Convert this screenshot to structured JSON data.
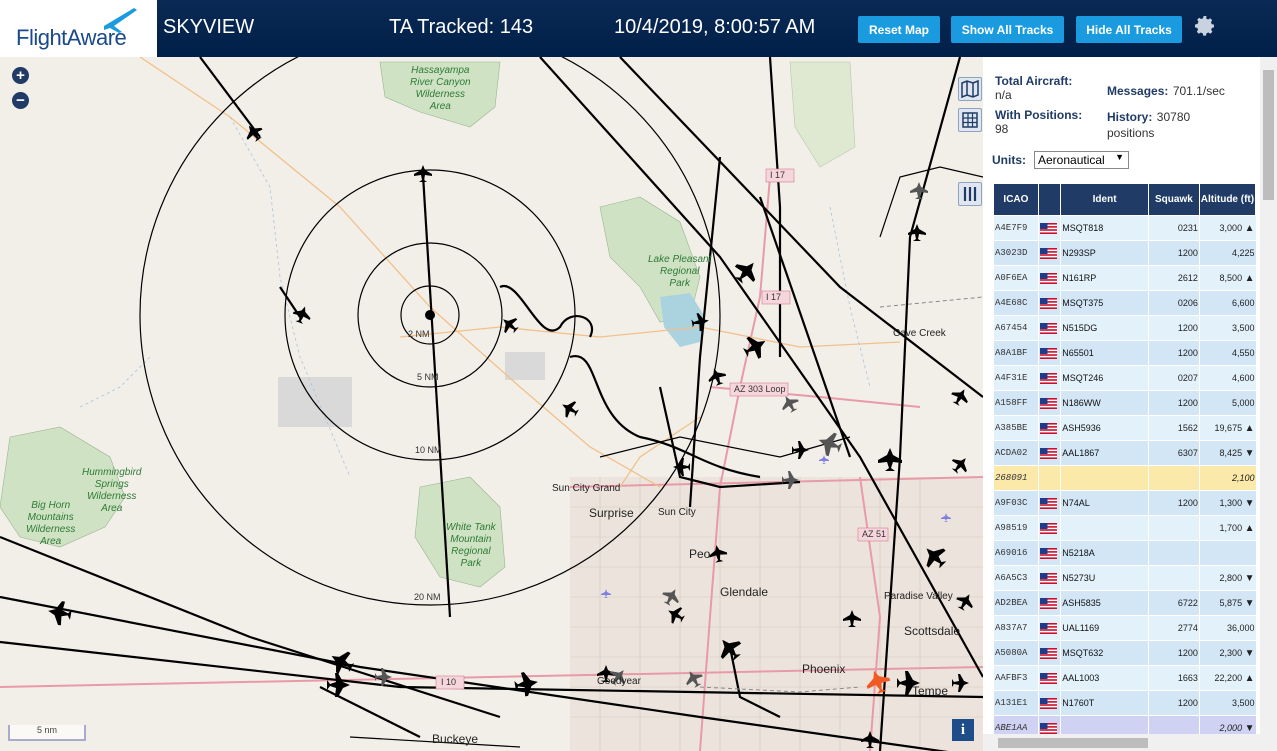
{
  "header": {
    "logo_text": "FlightAware",
    "app_title": "SKYVIEW",
    "tracked": "TA Tracked: 143",
    "datetime": "10/4/2019, 8:00:57 AM",
    "reset_map": "Reset Map",
    "show_all": "Show All Tracks",
    "hide_all": "Hide All Tracks"
  },
  "map": {
    "zoom_in": "+",
    "zoom_out": "−",
    "scale_label": "5 nm",
    "info": "i",
    "range_rings": [
      "2 NM",
      "5 NM",
      "10 NM",
      "20 NM"
    ],
    "places": [
      {
        "name": "Hassayampa River Canyon Wilderness Area",
        "lines": [
          "Hassayampa",
          "River Canyon",
          "Wilderness",
          "Area"
        ]
      },
      {
        "name": "Lake Pleasant Regional Park",
        "lines": [
          "Lake Pleasant",
          "Regional",
          "Park"
        ]
      },
      {
        "name": "Hummingbird Springs Wilderness Area",
        "lines": [
          "Hummingbird",
          "Springs",
          "Wilderness",
          "Area"
        ]
      },
      {
        "name": "Big Horn Mountains Wilderness Area",
        "lines": [
          "Big Horn",
          "Mountains",
          "Wilderness",
          "Area"
        ]
      },
      {
        "name": "White Tank Mountain Regional Park",
        "lines": [
          "White Tank",
          "Mountain",
          "Regional",
          "Park"
        ]
      }
    ],
    "cities": {
      "cave_creek": "Cave Creek",
      "sun_city_grand": "Sun City Grand",
      "surprise": "Surprise",
      "sun_city": "Sun City",
      "peoria": "Peo",
      "glendale": "Glendale",
      "paradise_valley": "Paradise Valley",
      "scottsdale": "Scottsdale",
      "phoenix": "Phoenix",
      "tempe": "Tempe",
      "goodyear": "Goodyear",
      "buckeye": "Buckeye"
    },
    "roads": {
      "i17_a": "I 17",
      "i17_b": "I 17",
      "loop303": "AZ 303 Loop",
      "i10": "I 10",
      "az51": "AZ 51"
    }
  },
  "stats": {
    "total_label": "Total Aircraft:",
    "total_value": "n/a",
    "messages_label": "Messages:",
    "messages_value": "701.1/sec",
    "positions_label": "With Positions:",
    "positions_value": "98",
    "history_label": "History:",
    "history_value": "30780",
    "history_unit": "positions",
    "units_label": "Units:",
    "units_value": "Aeronautical"
  },
  "table": {
    "headers": {
      "icao": "ICAO",
      "ident": "Ident",
      "squawk": "Squawk",
      "altitude": "Altitude (ft)"
    },
    "rows": [
      {
        "icao": "A4E7F9",
        "ident": "MSQT818",
        "squawk": "0231",
        "alt": "3,000",
        "trend": "▲"
      },
      {
        "icao": "A3023D",
        "ident": "N293SP",
        "squawk": "1200",
        "alt": "4,225",
        "trend": ""
      },
      {
        "icao": "A0F6EA",
        "ident": "N161RP",
        "squawk": "2612",
        "alt": "8,500",
        "trend": "▲"
      },
      {
        "icao": "A4E68C",
        "ident": "MSQT375",
        "squawk": "0206",
        "alt": "6,600",
        "trend": ""
      },
      {
        "icao": "A67454",
        "ident": "N515DG",
        "squawk": "1200",
        "alt": "3,500",
        "trend": ""
      },
      {
        "icao": "A8A1BF",
        "ident": "N65501",
        "squawk": "1200",
        "alt": "4,550",
        "trend": ""
      },
      {
        "icao": "A4F31E",
        "ident": "MSQT246",
        "squawk": "0207",
        "alt": "4,600",
        "trend": ""
      },
      {
        "icao": "A158FF",
        "ident": "N186WW",
        "squawk": "1200",
        "alt": "5,000",
        "trend": ""
      },
      {
        "icao": "A385BE",
        "ident": "ASH5936",
        "squawk": "1562",
        "alt": "19,675",
        "trend": "▲"
      },
      {
        "icao": "ACDA02",
        "ident": "AAL1867",
        "squawk": "6307",
        "alt": "8,425",
        "trend": "▼"
      },
      {
        "icao": "268091",
        "ident": "",
        "squawk": "",
        "alt": "2,100",
        "trend": ""
      },
      {
        "icao": "A9F03C",
        "ident": "N74AL",
        "squawk": "1200",
        "alt": "1,300",
        "trend": "▼"
      },
      {
        "icao": "A98519",
        "ident": "",
        "squawk": "",
        "alt": "1,700",
        "trend": "▲"
      },
      {
        "icao": "A69016",
        "ident": "N5218A",
        "squawk": "",
        "alt": "",
        "trend": ""
      },
      {
        "icao": "A6A5C3",
        "ident": "N5273U",
        "squawk": "",
        "alt": "2,800",
        "trend": "▼"
      },
      {
        "icao": "AD2BEA",
        "ident": "ASH5835",
        "squawk": "6722",
        "alt": "5,875",
        "trend": "▼"
      },
      {
        "icao": "A837A7",
        "ident": "UAL1169",
        "squawk": "2774",
        "alt": "36,000",
        "trend": ""
      },
      {
        "icao": "A5080A",
        "ident": "MSQT632",
        "squawk": "1200",
        "alt": "2,300",
        "trend": "▼"
      },
      {
        "icao": "AAFBF3",
        "ident": "AAL1003",
        "squawk": "1663",
        "alt": "22,200",
        "trend": "▲"
      },
      {
        "icao": "A131E1",
        "ident": "N1760T",
        "squawk": "1200",
        "alt": "3,500",
        "trend": ""
      },
      {
        "icao": "ABE1AA",
        "ident": "",
        "squawk": "",
        "alt": "2,000",
        "trend": "▼"
      }
    ]
  },
  "colors": {
    "header_bg": "#002049",
    "button": "#1a9be0",
    "table_header": "#1f3b66",
    "highlight_row": "#fae9a8",
    "selected_row": "#cfd2f2"
  }
}
